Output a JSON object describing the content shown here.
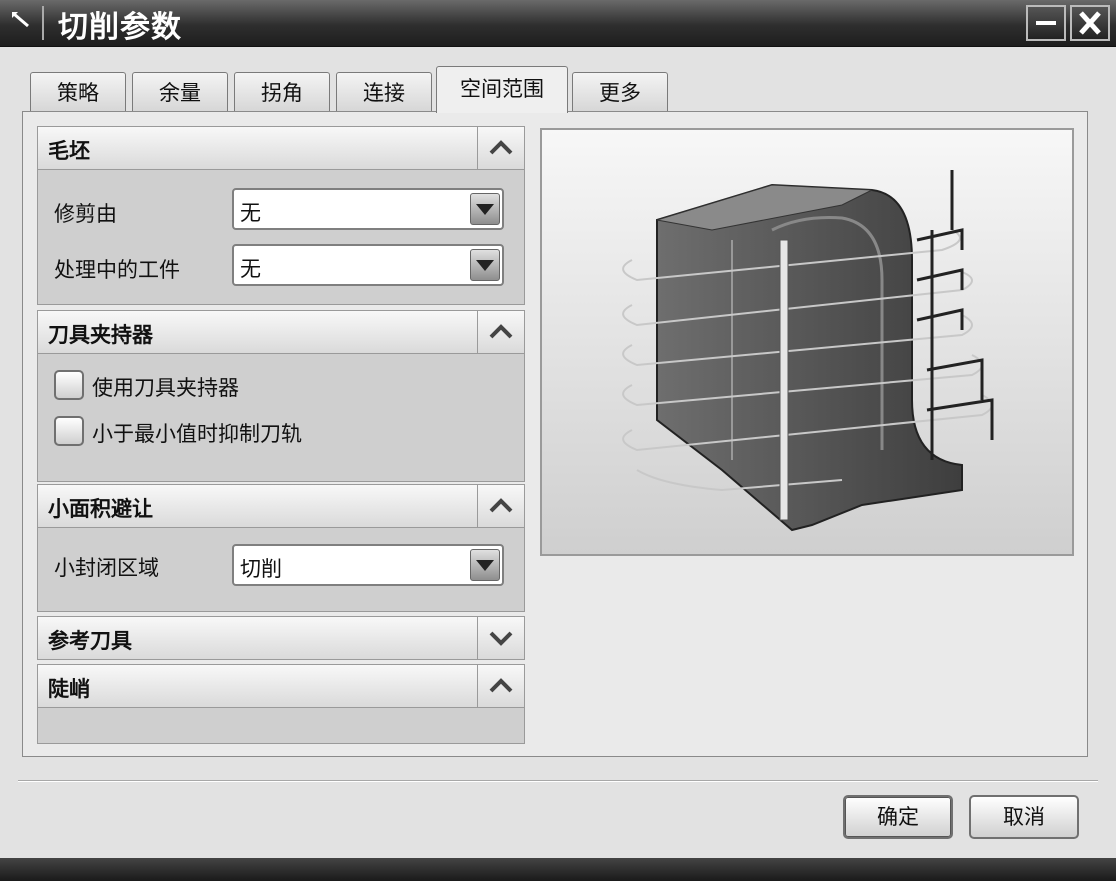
{
  "window": {
    "title": "切削参数"
  },
  "tabs": [
    {
      "label": "策略"
    },
    {
      "label": "余量"
    },
    {
      "label": "拐角"
    },
    {
      "label": "连接"
    },
    {
      "label": "空间范围",
      "active": true
    },
    {
      "label": "更多"
    }
  ],
  "sections": {
    "blank": {
      "title": "毛坯",
      "trim_label": "修剪由",
      "trim_value": "无",
      "ipw_label": "处理中的工件",
      "ipw_value": "无"
    },
    "holder": {
      "title": "刀具夹持器",
      "use_holder_label": "使用刀具夹持器",
      "use_holder_checked": false,
      "gouge_label": "小于最小值时抑制刀轨",
      "gouge_checked": false
    },
    "small_area": {
      "title": "小面积避让",
      "closed_label": "小封闭区域",
      "closed_value": "切削"
    },
    "ref_tool": {
      "title": "参考刀具",
      "expanded": false
    },
    "steep": {
      "title": "陡峭",
      "expanded": true
    }
  },
  "buttons": {
    "ok": "确定",
    "cancel": "取消"
  },
  "icons": [
    "tool-icon",
    "minimize-icon",
    "close-icon",
    "chevron-up-icon",
    "chevron-down-icon",
    "dropdown-arrow-icon"
  ]
}
